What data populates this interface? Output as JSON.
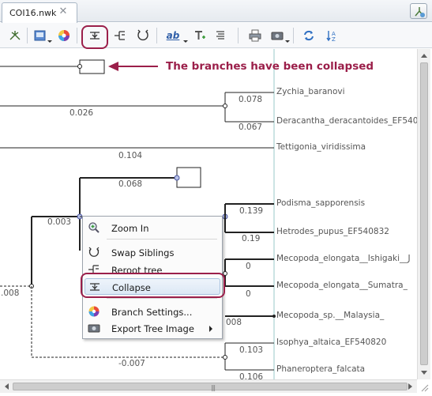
{
  "tab": {
    "title": "COI16.nwk",
    "close_glyph": "✕"
  },
  "toolbar": {
    "buttons": [
      {
        "icon": "reroot-icon",
        "has_dropdown": false
      },
      {
        "icon": "appearance-icon",
        "has_dropdown": true
      },
      {
        "icon": "color-wheel-icon",
        "has_dropdown": false
      },
      {
        "icon": "collapse-icon",
        "has_dropdown": false,
        "highlighted": true
      },
      {
        "icon": "reroot-tree-icon",
        "has_dropdown": false
      },
      {
        "icon": "swap-siblings-icon",
        "has_dropdown": false
      },
      {
        "icon": "text-ab-icon",
        "has_dropdown": true
      },
      {
        "icon": "text-add-icon",
        "has_dropdown": false
      },
      {
        "icon": "align-icon",
        "has_dropdown": false
      },
      {
        "icon": "print-icon",
        "has_dropdown": false
      },
      {
        "icon": "export-image-icon",
        "has_dropdown": true
      },
      {
        "icon": "refresh-icon",
        "has_dropdown": false
      },
      {
        "icon": "sort-az-icon",
        "has_dropdown": false
      }
    ],
    "text_ab": "ab"
  },
  "annotation": "The branches have been collapsed",
  "annotation_color": "#9b1f4a",
  "tree": {
    "branch_labels": [
      {
        "text": "0.078"
      },
      {
        "text": "0.026"
      },
      {
        "text": "0.067"
      },
      {
        "text": "0.104"
      },
      {
        "text": "0.068"
      },
      {
        "text": "0.003"
      },
      {
        "text": "0.139"
      },
      {
        "text": "0.19"
      },
      {
        "text": "0"
      },
      {
        "text": "0"
      },
      {
        "text": ".008"
      },
      {
        "text": "008"
      },
      {
        "text": "0.103"
      },
      {
        "text": "-0.007"
      },
      {
        "text": "0.106"
      }
    ],
    "leaves": [
      "Zychia_baranovi",
      "Deracantha_deracantoides_EF540",
      "Tettigonia_viridissima",
      "Podisma_sapporensis",
      "Hetrodes_pupus_EF540832",
      "Mecopoda_elongata__Ishigaki__J",
      "Mecopoda_elongata__Sumatra_",
      "Mecopoda_sp.__Malaysia_",
      "Isophya_altaica_EF540820",
      "Phaneroptera_falcata"
    ]
  },
  "context_menu": {
    "items": [
      {
        "label": "Zoom In",
        "icon": "zoom-in-icon"
      },
      {
        "label": "Swap Siblings",
        "icon": "swap-siblings-icon"
      },
      {
        "label": "Reroot tree",
        "icon": "reroot-tree-icon"
      },
      {
        "label": "Collapse",
        "icon": "collapse-icon",
        "highlighted": true
      },
      {
        "label": "Branch Settings...",
        "icon": "color-wheel-icon"
      },
      {
        "label": "Export Tree Image",
        "icon": "export-image-icon",
        "has_submenu": true
      }
    ]
  },
  "scrollbars": {
    "horizontal_grip": "|||"
  }
}
